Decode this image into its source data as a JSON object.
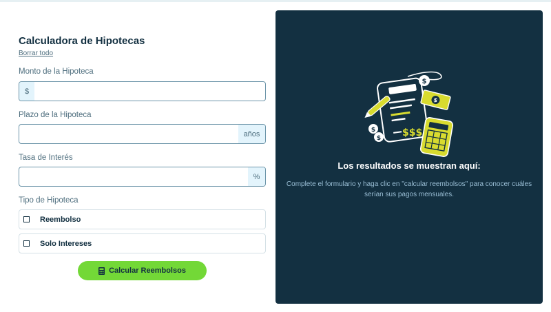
{
  "form": {
    "title": "Calculadora de Hipotecas",
    "clear_all": "Borrar todo",
    "amount": {
      "label": "Monto de la Hipoteca",
      "prefix": "$",
      "value": ""
    },
    "term": {
      "label": "Plazo de la Hipoteca",
      "suffix": "años",
      "value": ""
    },
    "rate": {
      "label": "Tasa de Interés",
      "suffix": "%",
      "value": ""
    },
    "type": {
      "label": "Tipo de Hipoteca",
      "options": [
        "Reembolso",
        "Solo Intereses"
      ]
    },
    "submit_label": "Calcular Reembolsos"
  },
  "results": {
    "title": "Los resultados se muestran aquí:",
    "description": "Complete el formulario y haga clic en \"calcular reembolsos\" para conocer cuáles serían sus pagos mensuales."
  },
  "colors": {
    "panel": "#133041",
    "lime": "#d8db2f",
    "button": "#73d837",
    "affix": "#e3f4fc"
  },
  "icons": {
    "submit": "calculator-icon",
    "illustration": "empty-results-illustration"
  }
}
